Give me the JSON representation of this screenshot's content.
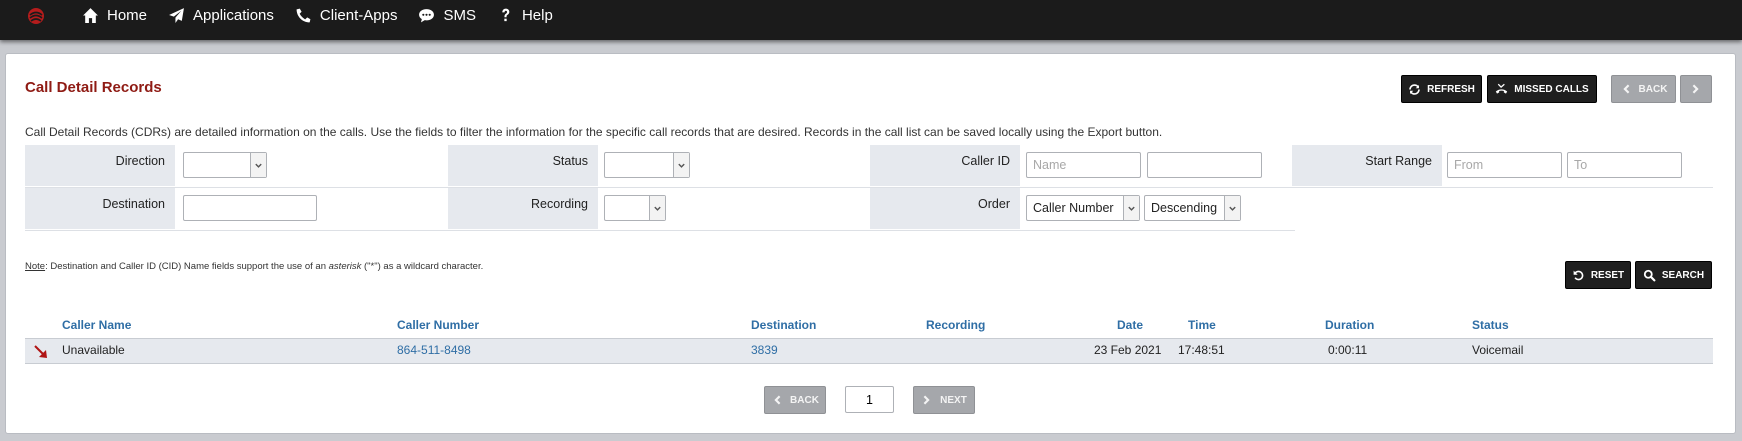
{
  "nav": {
    "items": [
      {
        "label": "Home",
        "icon": "home-icon"
      },
      {
        "label": "Applications",
        "icon": "paper-plane-icon"
      },
      {
        "label": "Client-Apps",
        "icon": "phone-icon"
      },
      {
        "label": "SMS",
        "icon": "chat-bubble-icon"
      },
      {
        "label": "Help",
        "icon": "question-icon"
      }
    ]
  },
  "page": {
    "title": "Call Detail Records",
    "description": "Call Detail Records (CDRs) are detailed information on the calls. Use the fields to filter the information for the specific call records that are desired. Records in the call list can be saved locally using the Export button."
  },
  "toolbar": {
    "refresh_label": "REFRESH",
    "missed_calls_label": "MISSED CALLS",
    "back_label": "BACK"
  },
  "filters": {
    "direction_label": "Direction",
    "direction_value": "",
    "status_label": "Status",
    "status_value": "",
    "caller_id_label": "Caller ID",
    "caller_id_name_placeholder": "Name",
    "caller_id_number_value": "",
    "start_range_label": "Start Range",
    "start_from_placeholder": "From",
    "start_to_placeholder": "To",
    "destination_label": "Destination",
    "destination_value": "",
    "recording_label": "Recording",
    "recording_value": "",
    "order_label": "Order",
    "order_by_value": "Caller Number",
    "order_dir_value": "Descending"
  },
  "note": {
    "prefix": "Note",
    "text1": ": Destination and Caller ID (CID) Name fields support the use of an ",
    "emphasis": "asterisk",
    "text2": " (\"*\") as a wildcard character."
  },
  "actions": {
    "reset_label": "RESET",
    "search_label": "SEARCH"
  },
  "table": {
    "headers": [
      "Caller Name",
      "Caller Number",
      "Destination",
      "Recording",
      "Date",
      "Time",
      "Duration",
      "Status"
    ],
    "rows": [
      {
        "direction_icon": "incoming-call-arrow-icon",
        "caller_name": "Unavailable",
        "caller_number": "864-511-8498",
        "destination": "3839",
        "recording": "",
        "date": "23 Feb 2021",
        "time": "17:48:51",
        "duration": "0:00:11",
        "status": "Voicemail"
      }
    ]
  },
  "pagination": {
    "back_label": "BACK",
    "next_label": "NEXT",
    "page_value": "1"
  },
  "colors": {
    "title": "#8f1b14",
    "link": "#2f6ea5",
    "label_bg": "#e6e9ee",
    "topbar": "#1b1b1b",
    "dark_button": "#1f1f1f",
    "disabled_button": "#a5a7ab",
    "incoming_arrow": "#b01414"
  }
}
